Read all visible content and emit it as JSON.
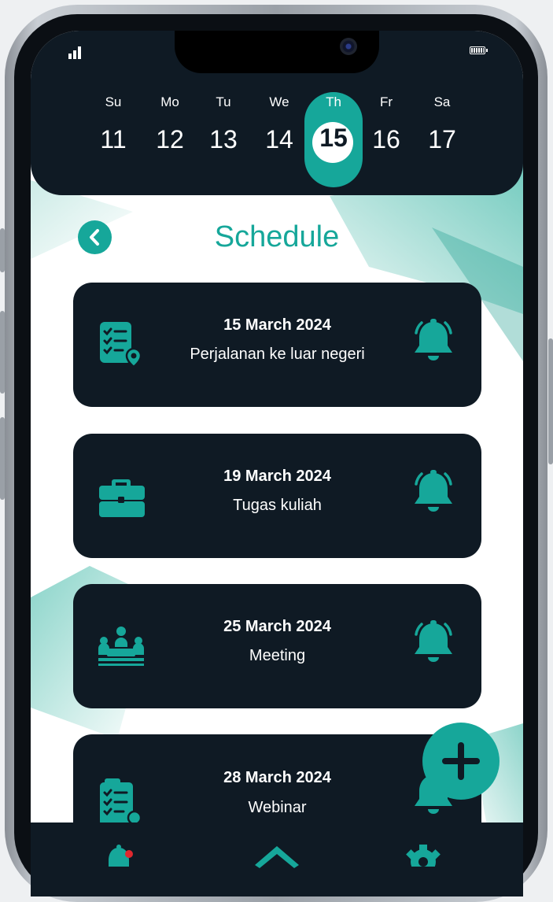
{
  "colors": {
    "accent": "#16a79a",
    "dark": "#0f1a24",
    "notification_dot": "#e0282e"
  },
  "status_bar": {
    "signal_icon": "signal-icon",
    "battery_icon": "battery-icon"
  },
  "week": {
    "days": [
      {
        "name": "Su",
        "num": "11"
      },
      {
        "name": "Mo",
        "num": "12"
      },
      {
        "name": "Tu",
        "num": "13"
      },
      {
        "name": "We",
        "num": "14"
      },
      {
        "name": "Th",
        "num": "15"
      },
      {
        "name": "Fr",
        "num": "16"
      },
      {
        "name": "Sa",
        "num": "17"
      }
    ],
    "selected_index": 4
  },
  "header": {
    "title": "Schedule",
    "back_icon": "chevron-left-icon"
  },
  "schedules": [
    {
      "date": "15 March 2024",
      "desc": "Perjalanan ke luar negeri",
      "icon": "checklist-location-icon"
    },
    {
      "date": "19 March 2024",
      "desc": "Tugas kuliah",
      "icon": "briefcase-icon"
    },
    {
      "date": "25 March 2024",
      "desc": "Meeting",
      "icon": "meeting-icon"
    },
    {
      "date": "28 March 2024",
      "desc": "Webinar",
      "icon": "checklist-icon"
    }
  ],
  "fab": {
    "icon": "plus-icon"
  },
  "bottom_nav": [
    "notification-bell-icon",
    "home-icon",
    "settings-gear-icon"
  ]
}
